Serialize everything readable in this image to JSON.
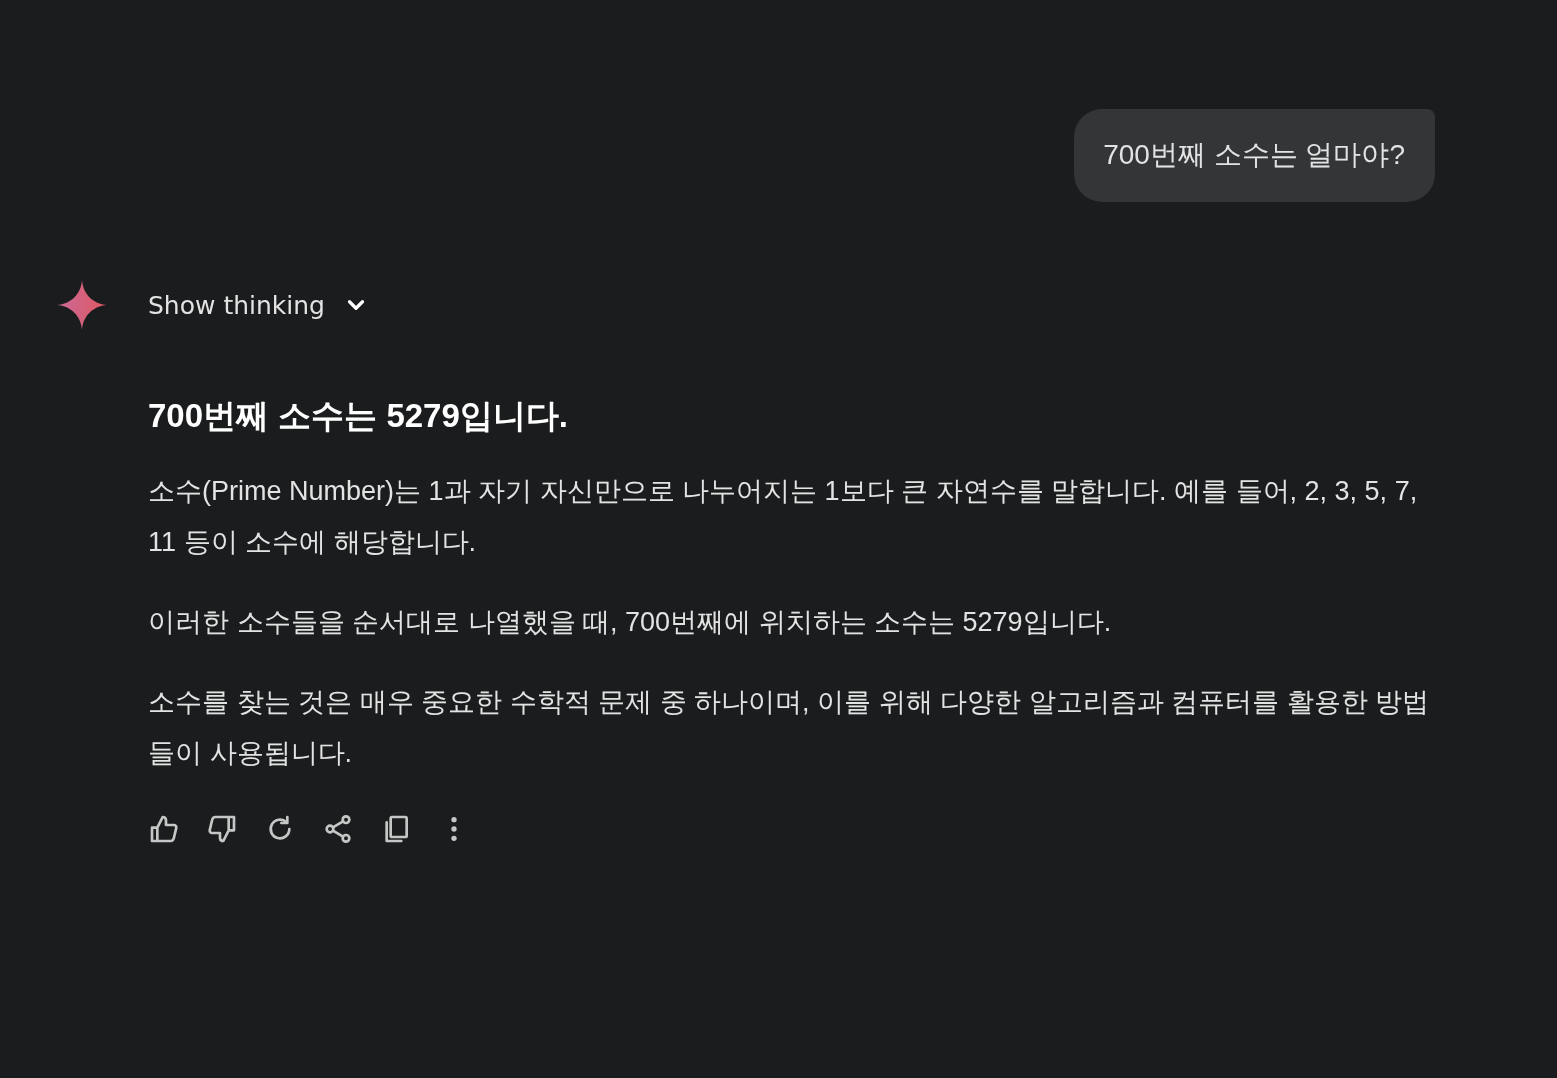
{
  "user_message": "700번째 소수는 얼마야?",
  "response": {
    "thinking_toggle": {
      "label": "Show thinking",
      "expanded": false
    },
    "heading": "700번째 소수는 5279입니다.",
    "paragraphs": [
      "소수(Prime Number)는 1과 자기 자신만으로 나누어지는 1보다 큰 자연수를 말합니다. 예를 들어, 2, 3, 5, 7, 11 등이 소수에 해당합니다.",
      "이러한 소수들을 순서대로 나열했을 때, 700번째에 위치하는 소수는 5279입니다.",
      "소수를 찾는 것은 매우 중요한 수학적 문제 중 하나이며, 이를 위해 다양한 알고리즘과 컴퓨터를 활용한 방법들이 사용됩니다."
    ]
  }
}
